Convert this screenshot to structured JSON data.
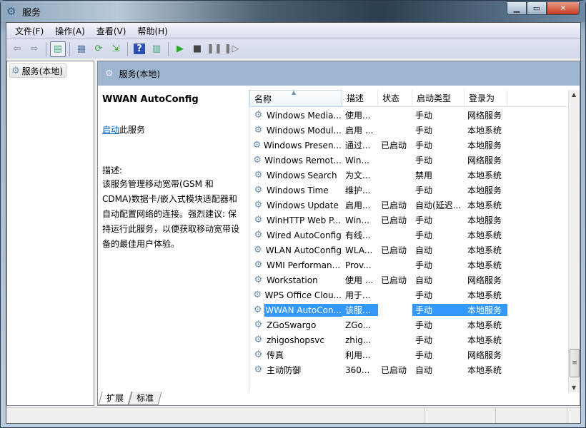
{
  "window": {
    "title": "服务",
    "icon": "services-gear-icon",
    "minimize": "minimize",
    "maximize": "maximize",
    "close": "close"
  },
  "menu": [
    "文件(F)",
    "操作(A)",
    "查看(V)",
    "帮助(H)"
  ],
  "toolbar": [
    "back-icon",
    "forward-icon",
    "show-hide-tree-icon",
    "properties-icon",
    "refresh-icon",
    "export-list-icon",
    "help-icon",
    "action-pane-icon",
    "start-icon",
    "stop-icon",
    "pause-icon",
    "resume-icon"
  ],
  "tree": {
    "item": "服务(本地)"
  },
  "band": {
    "title": "服务(本地)"
  },
  "detail": {
    "service_name": "WWAN AutoConfig",
    "action_link": "启动",
    "action_suffix": "此服务",
    "desc_label": "描述:",
    "description": "该服务管理移动宽带(GSM 和 CDMA)数据卡/嵌入式模块适配器和自动配置网络的连接。强烈建议: 保持运行此服务，以便获取移动宽带设备的最佳用户体验。"
  },
  "columns": [
    "名称",
    "描述",
    "状态",
    "启动类型",
    "登录为"
  ],
  "rows": [
    [
      "Windows Media...",
      "使用...",
      "",
      "手动",
      "网络服务"
    ],
    [
      "Windows Modul...",
      "启用 ...",
      "",
      "手动",
      "本地系统"
    ],
    [
      "Windows Presen...",
      "通过...",
      "已启动",
      "手动",
      "本地服务"
    ],
    [
      "Windows Remot...",
      "Win...",
      "",
      "手动",
      "网络服务"
    ],
    [
      "Windows Search",
      "为文...",
      "",
      "禁用",
      "本地系统"
    ],
    [
      "Windows Time",
      "维护...",
      "",
      "手动",
      "本地服务"
    ],
    [
      "Windows Update",
      "启用...",
      "已启动",
      "自动(延迟...",
      "本地系统"
    ],
    [
      "WinHTTP Web P...",
      "Win...",
      "已启动",
      "手动",
      "本地服务"
    ],
    [
      "Wired AutoConfig",
      "有线...",
      "",
      "手动",
      "本地系统"
    ],
    [
      "WLAN AutoConfig",
      "WLA...",
      "已启动",
      "自动",
      "本地系统"
    ],
    [
      "WMI Performan...",
      "Prov...",
      "",
      "手动",
      "本地系统"
    ],
    [
      "Workstation",
      "使用 ...",
      "已启动",
      "自动",
      "网络服务"
    ],
    [
      "WPS Office Clou...",
      "用于...",
      "",
      "手动",
      "本地系统"
    ],
    [
      "WWAN AutoCon...",
      "该服...",
      "",
      "手动",
      "本地服务"
    ],
    [
      "ZGoSwargo",
      "ZGo...",
      "",
      "手动",
      "本地系统"
    ],
    [
      "zhigoshopsvc",
      "zhig...",
      "",
      "手动",
      "本地系统"
    ],
    [
      "传真",
      "利用...",
      "",
      "手动",
      "网络服务"
    ],
    [
      "主动防御",
      "360...",
      "已启动",
      "自动",
      "本地系统"
    ]
  ],
  "selected_row": 13,
  "tabs": [
    "扩展",
    "标准"
  ],
  "colors": {
    "selection": "#3399ff",
    "band": "#9db5cf",
    "link": "#0066cc"
  }
}
